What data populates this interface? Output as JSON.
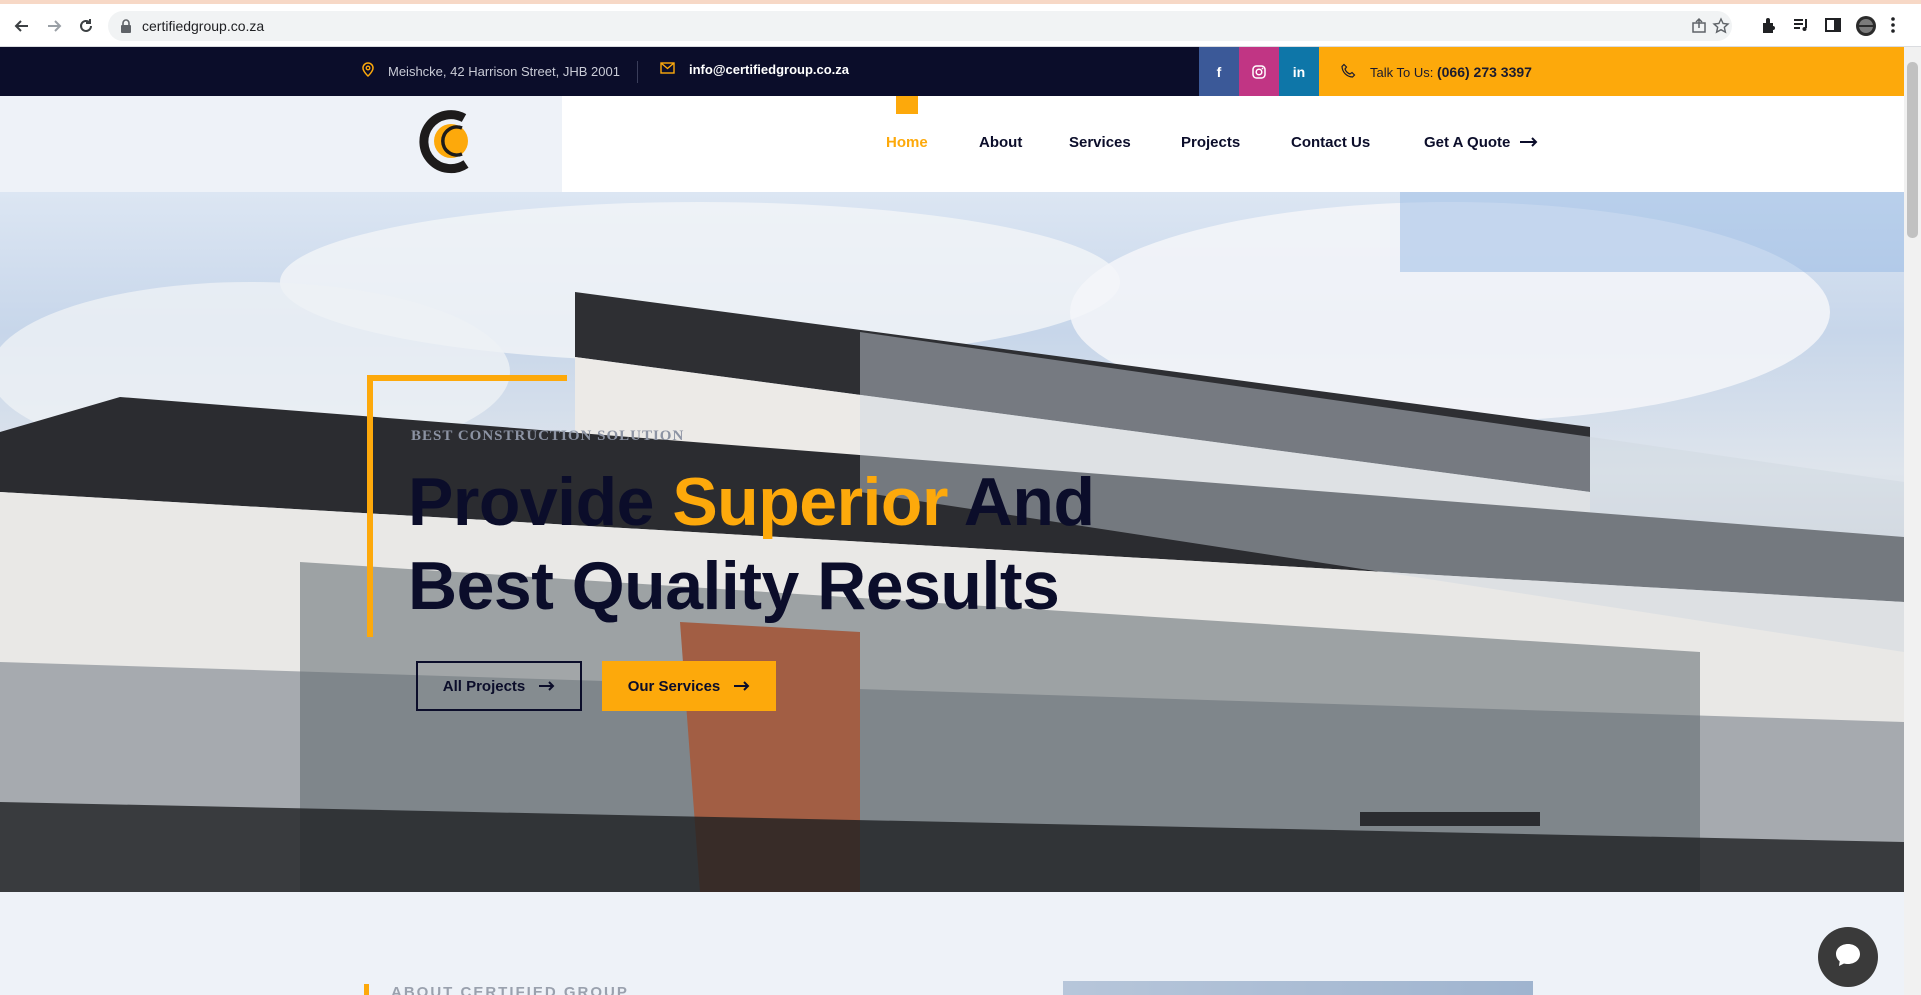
{
  "browser": {
    "url": "certifiedgroup.co.za"
  },
  "topbar": {
    "address": "Meishcke, 42 Harrison Street, JHB 2001",
    "email": "info@certifiedgroup.co.za",
    "social": [
      {
        "label": "f",
        "name": "facebook",
        "color": "#3b5998"
      },
      {
        "label": "◎",
        "name": "instagram",
        "color": "#c13584"
      },
      {
        "label": "in",
        "name": "linkedin",
        "color": "#0e76a8"
      }
    ],
    "phone_prefix": "Talk To Us:",
    "phone_number": "(066) 273 3397"
  },
  "nav": {
    "items": [
      "Home",
      "About",
      "Services",
      "Projects",
      "Contact Us"
    ],
    "active": "Home",
    "quote_label": "Get A Quote"
  },
  "hero": {
    "kicker": "BEST CONSTRUCTION SOLUTION",
    "title_part1": "Provide ",
    "title_highlight": "Superior",
    "title_part2": " And",
    "title_line2": "Best Quality Results",
    "btn_projects": "All Projects",
    "btn_services": "Our Services"
  },
  "about": {
    "label": "ABOUT CERTIFIED GROUP"
  },
  "colors": {
    "accent": "#fda90b",
    "navy": "#0b0d2a"
  }
}
